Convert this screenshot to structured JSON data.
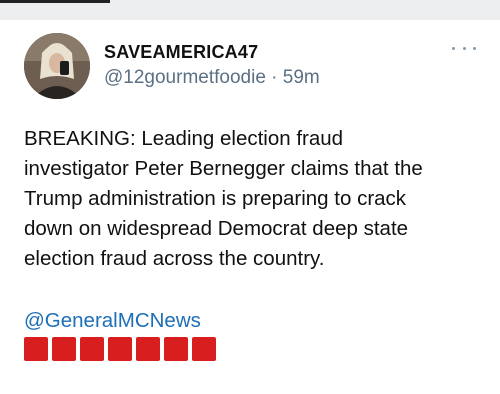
{
  "tweet": {
    "display_name": "SAVEAMERICA47",
    "handle": "@12gourmetfoodie",
    "separator": "·",
    "time": "59m",
    "lines": [
      "BREAKING: Leading election fraud",
      "investigator Peter Bernegger claims that the",
      "Trump administration is preparing to crack",
      "down on widespread Democrat deep state",
      "election fraud across the country."
    ],
    "mention": "@GeneralMCNews",
    "emoji_count": 7,
    "emoji_name": "red-square"
  },
  "colors": {
    "topbar": "#eceef0",
    "link": "#1d6fb8",
    "meta": "#5b7083",
    "emoji": "#d81e1e"
  }
}
